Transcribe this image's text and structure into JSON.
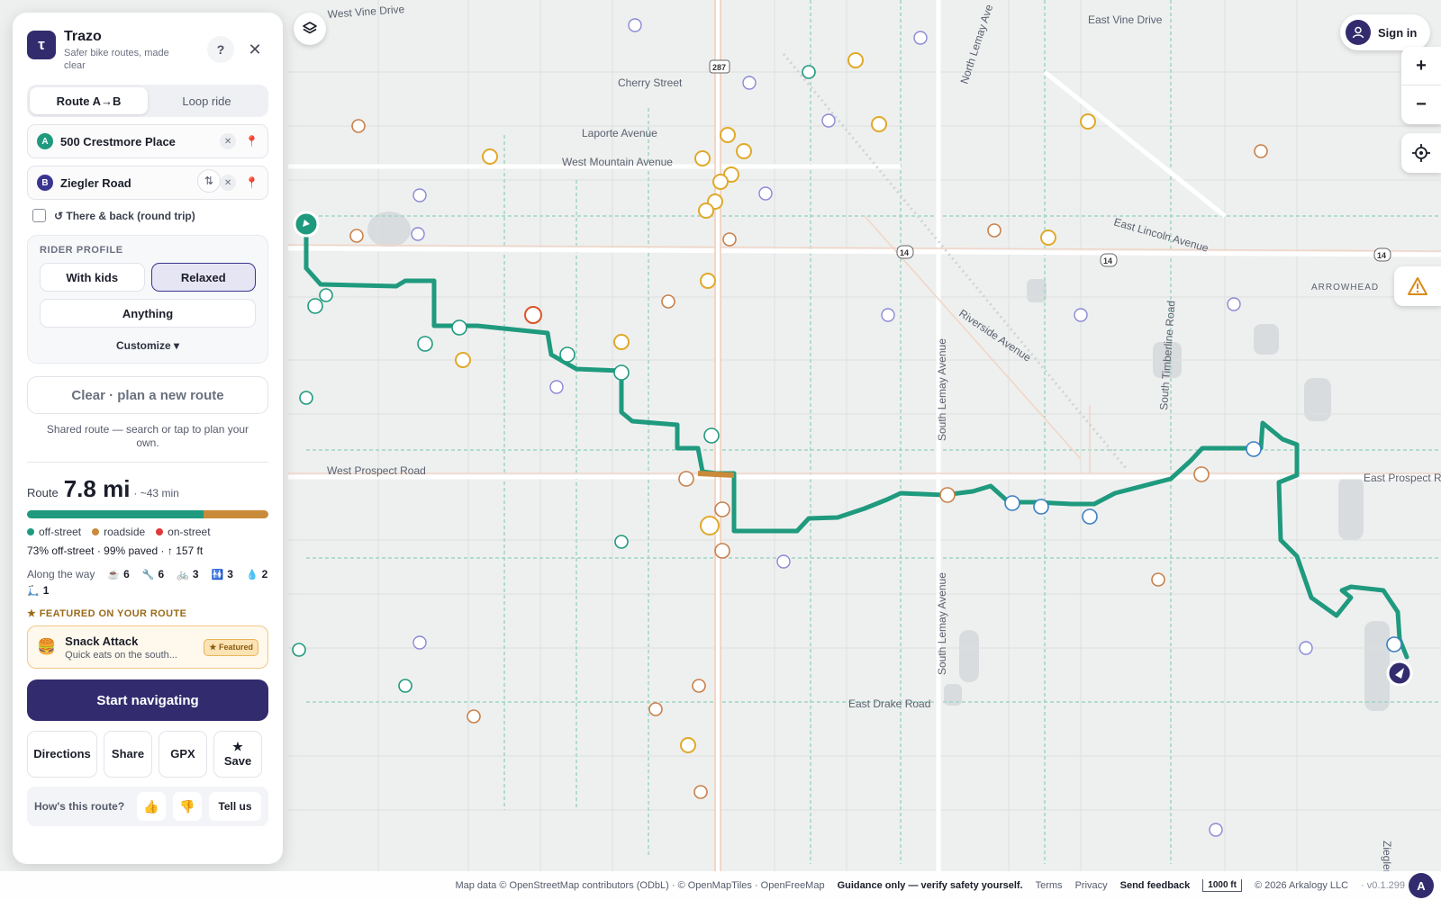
{
  "app": {
    "name": "Trazo",
    "tagline": "Safer bike routes, made clear",
    "help_label": "?",
    "close_label": "✕"
  },
  "mode_tabs": [
    {
      "label": "Route A→B",
      "active": true
    },
    {
      "label": "Loop ride",
      "active": false
    }
  ],
  "start": {
    "badge": "A",
    "value": "500 Crestmore Place"
  },
  "end": {
    "badge": "B",
    "value": "Ziegler Road"
  },
  "swap_icon": "⇅",
  "round_trip": {
    "label": "↺ There & back (round trip)",
    "checked": false
  },
  "rider_profile": {
    "title": "RIDER PROFILE",
    "options": [
      {
        "label": "With kids",
        "selected": false
      },
      {
        "label": "Relaxed",
        "selected": true
      },
      {
        "label": "Anything",
        "selected": false
      }
    ],
    "customize_label": "Customize ▾"
  },
  "clear_label": "Clear · plan a new route",
  "shared_note": "Shared route — search or tap to plan your own.",
  "route": {
    "label": "Route",
    "distance": "7.8 mi",
    "time": "· ~43 min",
    "offstreet_fraction": 0.73,
    "legend": [
      {
        "label": "off-street",
        "color": "#1f9a7e"
      },
      {
        "label": "roadside",
        "color": "#c98a3a"
      },
      {
        "label": "on-street",
        "color": "#e03a3a"
      }
    ],
    "stats": "73% off-street · 99% paved · ↑ 157 ft"
  },
  "along_the_way": {
    "label": "Along the way",
    "items": [
      {
        "icon": "cafe-icon",
        "glyph": "☕",
        "count": "6"
      },
      {
        "icon": "wrench-icon",
        "glyph": "🔧",
        "count": "6"
      },
      {
        "icon": "bike-icon",
        "glyph": "🚲",
        "count": "3"
      },
      {
        "icon": "restroom-icon",
        "glyph": "🚻",
        "count": "3"
      },
      {
        "icon": "water-icon",
        "glyph": "💧",
        "count": "2"
      },
      {
        "icon": "scooter-icon",
        "glyph": "🛴",
        "count": "1"
      }
    ]
  },
  "featured": {
    "title": "★ FEATURED ON YOUR ROUTE",
    "emoji": "🍔",
    "name": "Snack Attack",
    "desc": "Quick eats on the south...",
    "tag": "★ Featured"
  },
  "start_nav_label": "Start navigating",
  "actions": [
    {
      "name": "directions-button",
      "label": "Directions"
    },
    {
      "name": "share-button",
      "label": "Share"
    },
    {
      "name": "gpx-button",
      "label": "GPX"
    },
    {
      "name": "save-button",
      "label": "★\nSave"
    }
  ],
  "feedback": {
    "question": "How's this route?",
    "up": "👍",
    "down": "👎",
    "tell": "Tell us"
  },
  "map": {
    "route_color": "#1f9a7e",
    "roadside_color": "#c98a3a",
    "street_labels": [
      "West Vine Drive",
      "East Vine Drive",
      "Cherry Street",
      "Laporte Avenue",
      "West Mountain Avenue",
      "East Lincoln Avenue",
      "Riverside Avenue",
      "West Prospect Road",
      "East Prospect Ro",
      "South Lemay Avenue",
      "South Timberline Road",
      "North Lemay Ave",
      "ARROWHEAD",
      "East Drake Road",
      "Ziegler"
    ],
    "shields": [
      "287",
      "14",
      "14",
      "14"
    ]
  },
  "controls": {
    "sign_in": "Sign in",
    "zoom_in": "+",
    "zoom_out": "−"
  },
  "footer": {
    "attribution": "Map data © OpenStreetMap contributors (ODbL) · © OpenMapTiles · OpenFreeMap",
    "guidance": "Guidance only — verify safety yourself.",
    "terms": "Terms",
    "privacy": "Privacy",
    "send_feedback": "Send feedback",
    "scale": "1000 ft",
    "copyright": "© 2026 Arkalogy LLC",
    "version": "· v0.1.299",
    "logo": "A"
  }
}
